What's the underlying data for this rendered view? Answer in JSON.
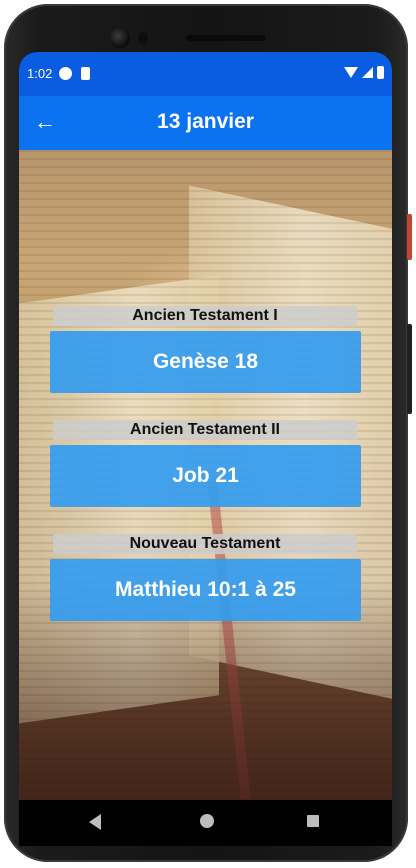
{
  "status": {
    "time": "1:02"
  },
  "appbar": {
    "title": "13 janvier",
    "back_icon": "arrow-left-icon"
  },
  "sections": [
    {
      "label": "Ancien Testament I",
      "reading": "Genèse 18"
    },
    {
      "label": "Ancien Testament II",
      "reading": "Job 21"
    },
    {
      "label": "Nouveau Testament",
      "reading": "Matthieu 10:1 à 25"
    }
  ],
  "colors": {
    "status_bar": "#0a5ce0",
    "app_bar": "#0c73f0",
    "reading_button": "#349cef",
    "section_label_bg": "#cdcdcd"
  }
}
